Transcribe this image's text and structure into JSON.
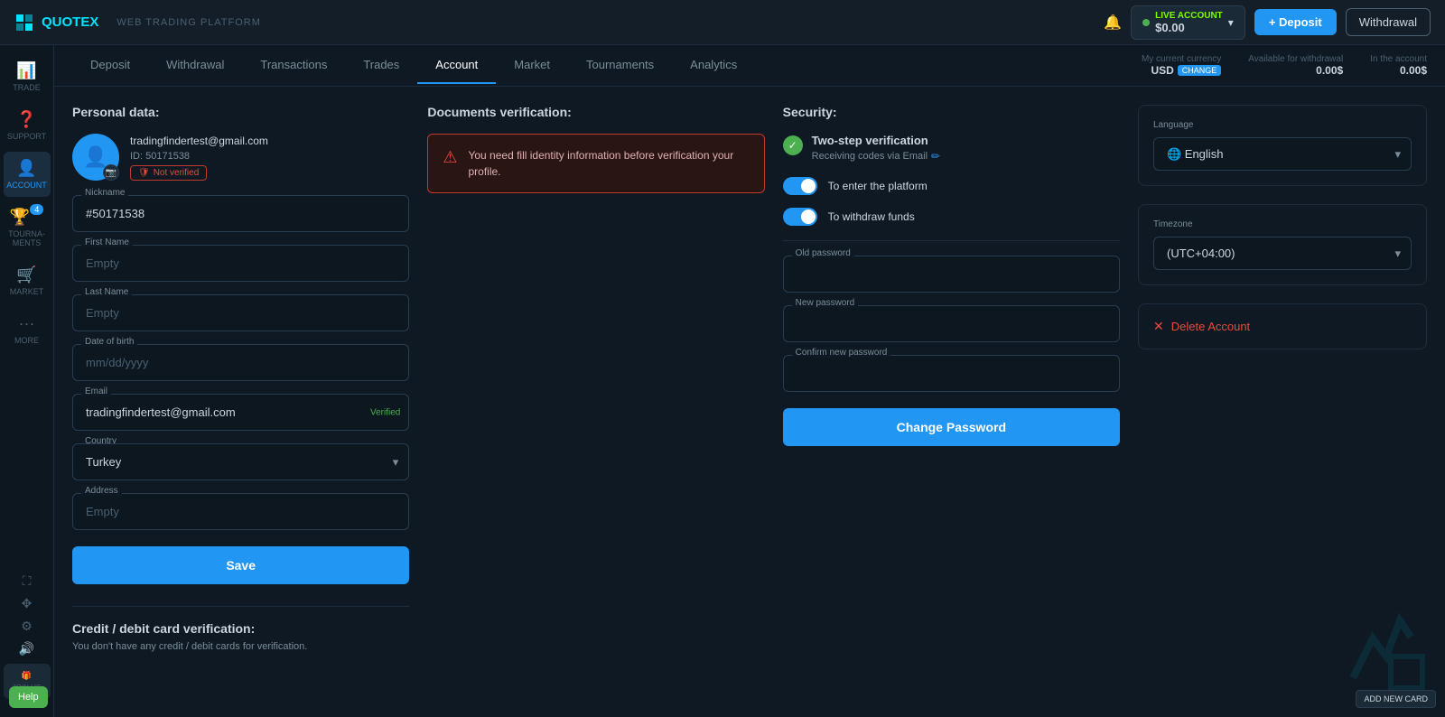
{
  "app": {
    "logo": "QUOTEX",
    "platform": "WEB TRADING PLATFORM"
  },
  "topbar": {
    "live_label": "LIVE ACCOUNT",
    "balance": "$0.00",
    "deposit_label": "+ Deposit",
    "withdrawal_label": "Withdrawal"
  },
  "currency_bar": {
    "current_label": "My current currency",
    "current_currency": "USD",
    "change_label": "CHANGE",
    "available_label": "Available for withdrawal",
    "available_value": "0.00$",
    "in_account_label": "In the account",
    "in_account_value": "0.00$"
  },
  "secondary_nav": {
    "tabs": [
      "Deposit",
      "Withdrawal",
      "Transactions",
      "Trades",
      "Account",
      "Market",
      "Tournaments",
      "Analytics"
    ],
    "active": "Account"
  },
  "sidebar": {
    "items": [
      {
        "label": "TRADE",
        "icon": "📊"
      },
      {
        "label": "SUPPORT",
        "icon": "❓"
      },
      {
        "label": "ACCOUNT",
        "icon": "👤",
        "active": true
      },
      {
        "label": "TOURNA-MENTS",
        "icon": "🏆",
        "badge": "4"
      },
      {
        "label": "MARKET",
        "icon": "🛒"
      },
      {
        "label": "MORE",
        "icon": "···"
      }
    ]
  },
  "personal": {
    "section_title": "Personal data:",
    "email": "tradingfindertest@gmail.com",
    "id": "ID: 50171538",
    "not_verified": "Not verified",
    "nickname_label": "Nickname",
    "nickname_value": "#50171538",
    "first_name_label": "First Name",
    "first_name_placeholder": "Empty",
    "last_name_label": "Last Name",
    "last_name_placeholder": "Empty",
    "dob_label": "Date of birth",
    "dob_placeholder": "mm/dd/yyyy",
    "email_label": "Email",
    "email_value": "tradingfindertest@gmail.com",
    "verified_label": "Verified",
    "country_label": "Country",
    "country_value": "Turkey",
    "address_label": "Address",
    "address_placeholder": "Empty",
    "save_label": "Save"
  },
  "documents": {
    "section_title": "Documents verification:",
    "alert": "You need fill identity information before verification your profile."
  },
  "security": {
    "section_title": "Security:",
    "two_step_title": "Two-step verification",
    "two_step_sub": "Receiving codes via Email",
    "toggle1_label": "To enter the platform",
    "toggle2_label": "To withdraw funds",
    "old_password_label": "Old password",
    "new_password_label": "New password",
    "confirm_password_label": "Confirm new password",
    "change_password_btn": "Change Password"
  },
  "settings": {
    "language_label": "Language",
    "language_value": "English",
    "timezone_label": "Timezone",
    "timezone_value": "(UTC+04:00)",
    "delete_account": "Delete Account"
  },
  "credit": {
    "title": "Credit / debit card verification:",
    "sub": "You don't have any credit / debit cards for verification."
  },
  "bottom": {
    "help_label": "Help",
    "add_card_label": "ADD NEW CARD"
  }
}
